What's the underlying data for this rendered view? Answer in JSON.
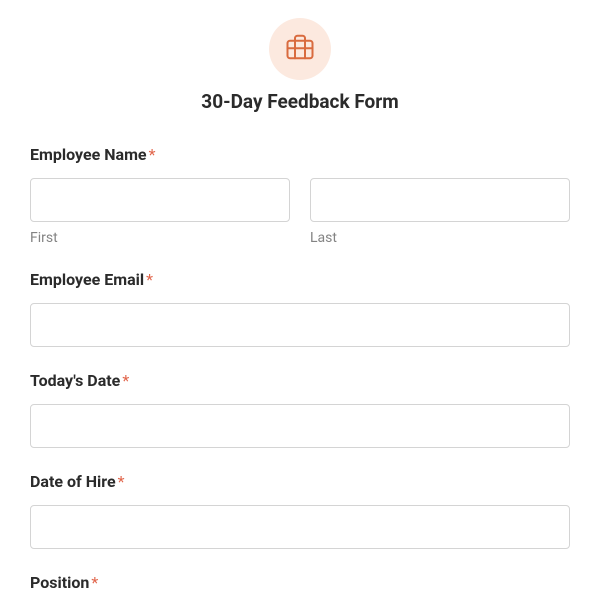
{
  "header": {
    "title": "30-Day Feedback Form"
  },
  "fields": {
    "employee_name": {
      "label": "Employee Name",
      "required": "*",
      "first_sublabel": "First",
      "last_sublabel": "Last",
      "first_value": "",
      "last_value": ""
    },
    "employee_email": {
      "label": "Employee Email",
      "required": "*",
      "value": ""
    },
    "todays_date": {
      "label": "Today's Date",
      "required": "*",
      "value": ""
    },
    "date_of_hire": {
      "label": "Date of Hire",
      "required": "*",
      "value": ""
    },
    "position": {
      "label": "Position",
      "required": "*",
      "value": ""
    }
  }
}
